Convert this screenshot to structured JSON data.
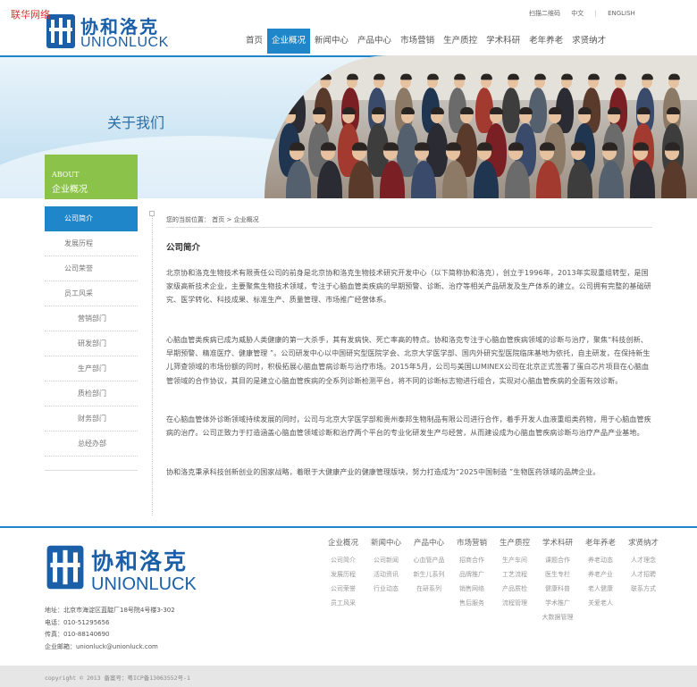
{
  "watermark": "联华网络",
  "header": {
    "logo_cn": "协和洛克",
    "logo_en": "UNIONLUCK",
    "qr_label": "扫描二维码",
    "lang_cn": "中文",
    "lang_sep": "|",
    "lang_en": "ENGLISH",
    "nav": [
      {
        "label": "首页"
      },
      {
        "label": "企业概况"
      },
      {
        "label": "新闻中心"
      },
      {
        "label": "产品中心"
      },
      {
        "label": "市场营销"
      },
      {
        "label": "生产质控"
      },
      {
        "label": "学术科研"
      },
      {
        "label": "老年养老"
      },
      {
        "label": "求贤纳才"
      }
    ],
    "active_nav": "企业概况"
  },
  "banner": {
    "title": "关于我们",
    "about_en": "ABOUT",
    "about_cn": "企业概况"
  },
  "sidebar": {
    "items": [
      {
        "label": "公司简介",
        "active": true
      },
      {
        "label": "发展历程"
      },
      {
        "label": "公司荣誉"
      },
      {
        "label": "员工风采"
      },
      {
        "label": "营销部门",
        "sub": true
      },
      {
        "label": "研发部门",
        "sub": true
      },
      {
        "label": "生产部门",
        "sub": true
      },
      {
        "label": "质检部门",
        "sub": true
      },
      {
        "label": "财务部门",
        "sub": true
      },
      {
        "label": "总经办部",
        "sub": true
      }
    ]
  },
  "breadcrumb": {
    "prefix": "您的当前位置：",
    "home": "首页",
    "sep": ">",
    "current": "企业概况"
  },
  "content": {
    "title": "公司简介",
    "paragraphs": [
      "北京协和洛克生物技术有限责任公司的前身是北京协和洛克生物技术研究开发中心（以下简称协和洛克），创立于1996年，2013年实现重组转型，是国家级高新技术企业，主要聚焦生物技术领域，专注于心脑血管类疾病的早期预警、诊断、治疗等相关产品研发及生产体系的建立。公司拥有完整的基础研究、医学转化、科技成果、标准生产、质量管理、市场推广经营体系。",
      "心脑血管类疾病已成为威胁人类健康的第一大杀手，其有发病快、死亡率高的特点。协和洛克专注于心脑血管疾病领域的诊断与治疗，聚焦“科技创新、早期预警、精准医疗、健康管理 ”。公司研发中心以中国研究型医院学会、北京大学医学部、国内外研究型医院临床基地为依托，自主研发，在保持新生儿筛查领域的市场份额的同时，积极拓展心脑血管病诊断与治疗市场。2015年5月，公司与美国LUMINEX公司在北京正式签署了蛋白芯片项目在心脑血管领域的合作协议，其目的是建立心脑血管疾病的全系列诊断检测平台，将不同的诊断标志物进行组合，实现对心脑血管疾病的全面有效诊断。",
      "在心脑血管体外诊断领域持续发展的同时，公司与北京大学医学部和贵州泰邦生物制品有限公司进行合作，着手开发人血液重组类药物，用于心脑血管疾病的治疗。公司正致力于打造涵盖心脑血管领域诊断和治疗两个平台的专业化研发生产与经营，从而建设成为心脑血管疾病诊断与治疗产品产业基地。",
      "协和洛克秉承科技创新创业的国家战略，着眼于大健康产业的健康管理版块，努力打造成为“2025中国制造 ”生物医药领域的品牌企业。"
    ]
  },
  "footer": {
    "logo_cn": "协和洛克",
    "logo_en": "UNIONLUCK",
    "address": "地址：北京市海淀区蓝靛厂18号院4号楼3-302",
    "phone": "电话：010-51295656",
    "fax": "传真：010-88140690",
    "email": "企业邮箱：unionluck@unionluck.com",
    "columns": [
      {
        "title": "企业概况",
        "links": [
          "公司简介",
          "发展历程",
          "公司荣誉",
          "员工风采"
        ]
      },
      {
        "title": "新闻中心",
        "links": [
          "公司新闻",
          "活动资讯",
          "行业动态"
        ]
      },
      {
        "title": "产品中心",
        "links": [
          "心血管产品",
          "新生儿系列",
          "在研系列"
        ]
      },
      {
        "title": "市场营销",
        "links": [
          "招商合作",
          "品牌推广",
          "销售网络",
          "售后服务"
        ]
      },
      {
        "title": "生产质控",
        "links": [
          "生产车间",
          "工艺流程",
          "产品质检",
          "流程管理"
        ]
      },
      {
        "title": "学术科研",
        "links": [
          "课题合作",
          "医生专栏",
          "健康科普",
          "学术推广",
          "大数据管理"
        ]
      },
      {
        "title": "老年养老",
        "links": [
          "养老动态",
          "养老产业",
          "老人健康",
          "关爱老人"
        ]
      },
      {
        "title": "求贤纳才",
        "links": [
          "人才理念",
          "人才招聘",
          "联系方式"
        ]
      }
    ],
    "copyright": "copyright © 2013 备案号：粤ICP备13063552号-1"
  },
  "colors": {
    "primary_blue": "#1f86c9",
    "logo_blue": "#1a5fa8",
    "about_green": "#8bc34a"
  }
}
